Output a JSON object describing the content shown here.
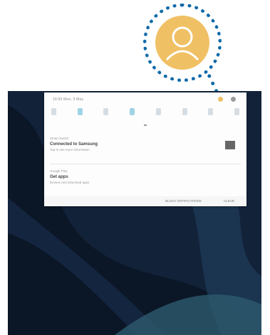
{
  "status_bar": {
    "text": "16:00  Mon, 5 May"
  },
  "quick_settings": {
    "tiles": [
      "wifi-icon",
      "bluetooth-icon",
      "sound-icon",
      "rotation-icon",
      "power-saving-icon",
      "airplane-icon",
      "location-icon",
      "flashlight-icon"
    ],
    "active_index": 1
  },
  "notifications": [
    {
      "app": "Smart Switch",
      "title": "Connected to Samsung",
      "subtitle": "Tap to see more information"
    },
    {
      "app": "Google Play",
      "title": "Get apps",
      "subtitle": "Browse and download apps"
    }
  ],
  "footer": {
    "block": "BLOCK NOTIFICATIONS",
    "clear": "CLEAR"
  },
  "colors": {
    "callout_border": "#0f6aa8",
    "avatar_fill": "#f0c064",
    "panel_bg": "#fdfdfd",
    "wallpaper": "#0b1626"
  }
}
